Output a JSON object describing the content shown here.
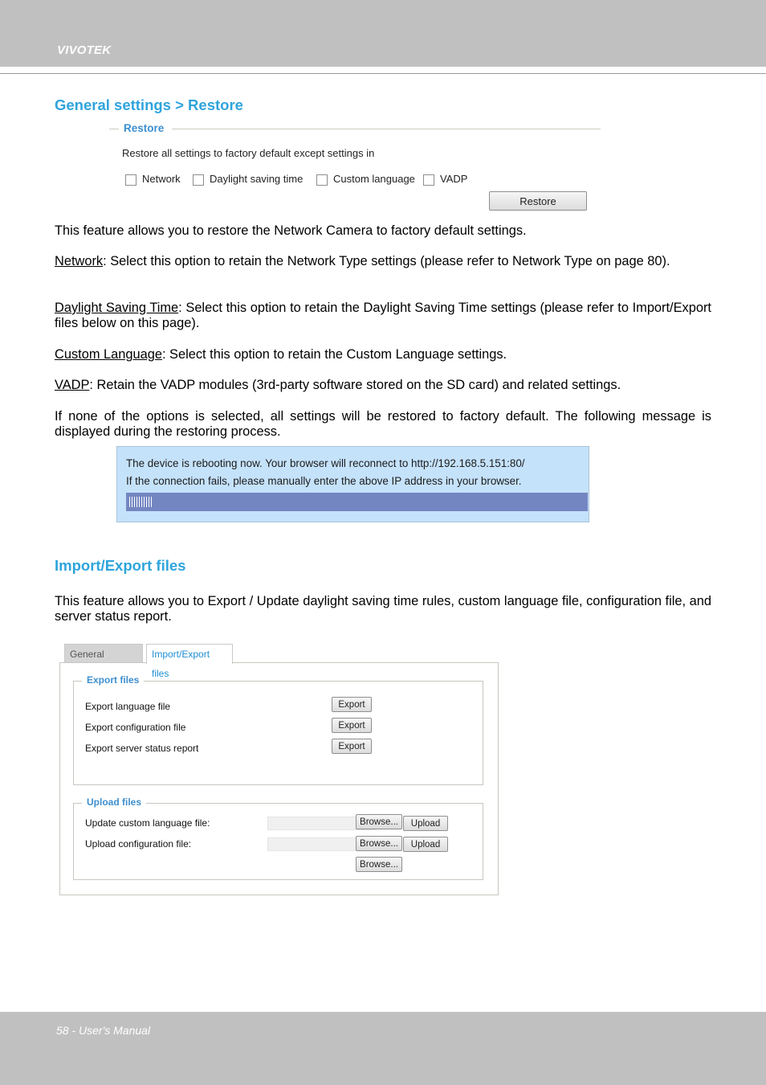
{
  "header": {
    "brand": "VIVOTEK"
  },
  "footer": {
    "page_label": "58 - User's Manual"
  },
  "restore_section": {
    "title": "General settings > Restore",
    "panel": {
      "legend": "Restore",
      "description": "Restore all settings to factory default except settings in",
      "options": [
        {
          "label": "Network",
          "checked": false
        },
        {
          "label": "Daylight saving time",
          "checked": false
        },
        {
          "label": "Custom language",
          "checked": false
        },
        {
          "label": "VADP",
          "checked": false
        }
      ],
      "restore_button": "Restore"
    },
    "paragraphs": {
      "intro": "This feature allows you to restore the Network Camera to factory default settings.",
      "network_term": "Network",
      "network_text": ": Select this option to retain the Network Type settings (please refer to Network Type on page 80).",
      "dst_term": "Daylight Saving Time",
      "dst_text": ": Select this option to retain the Daylight Saving Time settings (please refer to Import/Export files below on this page).",
      "custom_lang_term": "Custom Language",
      "custom_lang_text": ": Select this option to retain the Custom Language settings.",
      "vadp_term": "VADP",
      "vadp_text": ": Retain the VADP modules (3rd-party software stored on the SD card) and related settings.",
      "none_selected": "If none of the options is selected, all settings will be restored to factory default.  The following message is displayed during the restoring process."
    },
    "reboot_message": {
      "line1": "The device is rebooting now. Your browser will reconnect to http://192.168.5.151:80/",
      "line2": "If the connection fails, please manually enter the above IP address in your browser.",
      "progress_percent": 14
    }
  },
  "import_export_section": {
    "title": "Import/Export files",
    "description": "This feature allows you to Export / Update daylight saving time rules, custom language file, configuration file, and server status report.",
    "tabs": [
      {
        "label": "General settings",
        "active": false
      },
      {
        "label": "Import/Export files",
        "active": true
      }
    ],
    "export_files": {
      "legend": "Export files",
      "rows": [
        {
          "label": "Export language file",
          "button": "Export"
        },
        {
          "label": "Export configuration file",
          "button": "Export"
        },
        {
          "label": "Export server status report",
          "button": "Export"
        }
      ]
    },
    "upload_files": {
      "legend": "Upload files",
      "rows": [
        {
          "label": "Update custom language file:",
          "browse": "Browse...",
          "upload": "Upload",
          "value": ""
        },
        {
          "label": "Upload configuration file:",
          "browse": "Browse...",
          "upload": "Upload",
          "value": ""
        }
      ],
      "extra_browse": "Browse..."
    }
  }
}
